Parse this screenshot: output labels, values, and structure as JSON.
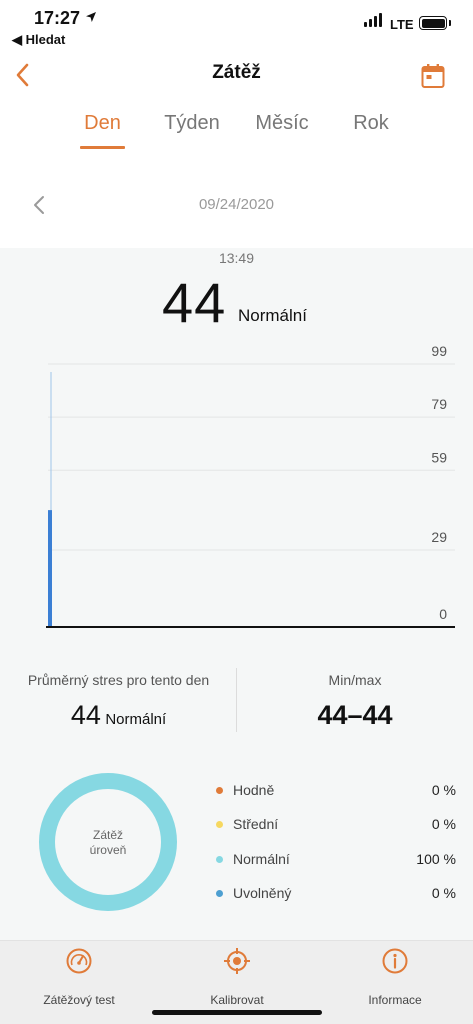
{
  "status_bar": {
    "time": "17:27",
    "back_app": "◀ Hledat",
    "network": "LTE"
  },
  "header": {
    "title": "Zátěž"
  },
  "tabs": [
    {
      "label": "Den",
      "active": true
    },
    {
      "label": "Týden",
      "active": false
    },
    {
      "label": "Měsíc",
      "active": false
    },
    {
      "label": "Rok",
      "active": false
    }
  ],
  "date": "09/24/2020",
  "reading": {
    "time": "13:49",
    "value": "44",
    "label": "Normální"
  },
  "chart_data": {
    "type": "bar",
    "y_ticks": [
      "99",
      "79",
      "59",
      "29",
      "0"
    ],
    "ylim": [
      0,
      99
    ],
    "values": [
      44
    ],
    "grid": true,
    "bar_color": "#3b7fd4"
  },
  "summary": {
    "avg_caption": "Průměrný stres pro tento den",
    "avg_value": "44",
    "avg_label": "Normální",
    "minmax_caption": "Min/max",
    "minmax_value": "44–44"
  },
  "donut": {
    "line1": "Zátěž",
    "line2": "úroveň",
    "color": "#86d8e2"
  },
  "legend": [
    {
      "name": "Hodně",
      "value": "0 %",
      "color": "#e07b39"
    },
    {
      "name": "Střední",
      "value": "0 %",
      "color": "#f6d860"
    },
    {
      "name": "Normální",
      "value": "100 %",
      "color": "#86d8e2"
    },
    {
      "name": "Uvolněný",
      "value": "0 %",
      "color": "#4d9fd1"
    }
  ],
  "tabbar": [
    {
      "label": "Zátěžový test",
      "icon": "gauge-icon"
    },
    {
      "label": "Kalibrovat",
      "icon": "crosshair-icon"
    },
    {
      "label": "Informace",
      "icon": "info-icon"
    }
  ],
  "accent_color": "#e07b39"
}
